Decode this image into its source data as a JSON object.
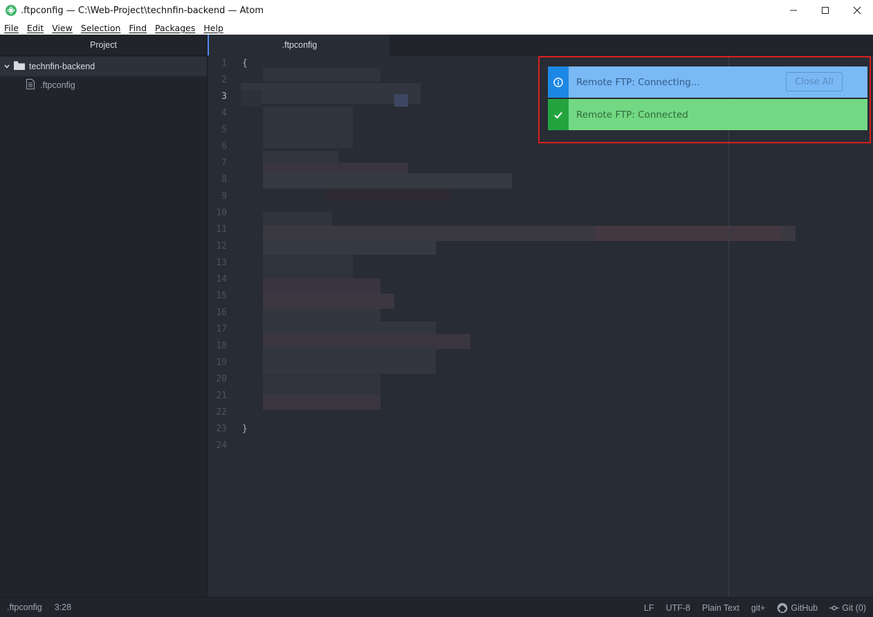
{
  "window": {
    "title": ".ftpconfig — C:\\Web-Project\\technfin-backend — Atom",
    "controls": [
      "minimize",
      "maximize",
      "close"
    ]
  },
  "menu": [
    "File",
    "Edit",
    "View",
    "Selection",
    "Find",
    "Packages",
    "Help"
  ],
  "tree": {
    "header": "Project",
    "root": "technfin-backend",
    "files": [
      ".ftpconfig"
    ]
  },
  "editor": {
    "tab": ".ftpconfig",
    "line_numbers": [
      "1",
      "2",
      "3",
      "4",
      "5",
      "6",
      "7",
      "8",
      "9",
      "10",
      "11",
      "12",
      "13",
      "14",
      "15",
      "16",
      "17",
      "18",
      "19",
      "20",
      "21",
      "22",
      "23",
      "24"
    ],
    "current_line": 3,
    "line1": "{",
    "line23": "}"
  },
  "notifications": {
    "info_message": "Remote FTP: Connecting...",
    "close_all": "Close All",
    "success_message": "Remote FTP: Connected"
  },
  "status": {
    "file": ".ftpconfig",
    "cursor": "3:28",
    "line_ending": "LF",
    "encoding": "UTF-8",
    "grammar": "Plain Text",
    "gitplus": "git+",
    "github": "GitHub",
    "git": "Git (0)"
  },
  "colors": {
    "editor_bg": "#282c34",
    "panel_bg": "#21252b",
    "info": "#7ab9f5",
    "success": "#73d883",
    "highlight_border": "#d81e1e"
  }
}
